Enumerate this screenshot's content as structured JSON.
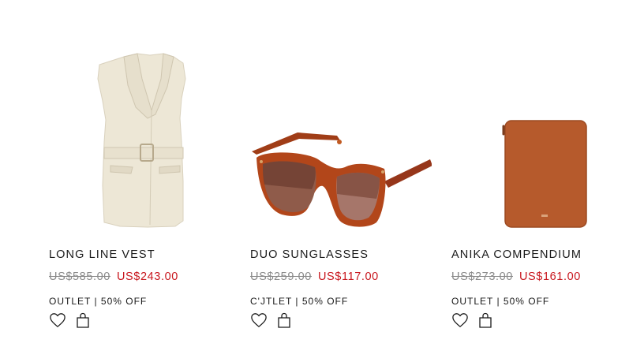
{
  "products": [
    {
      "name": "LONG LINE VEST",
      "original_price": "US$585.00",
      "sale_price": "US$243.00",
      "badge": "OUTLET | 50% OFF",
      "image_icon": "vest-image",
      "wishlist_icon": "heart-icon",
      "bag_icon": "shopping-bag-icon"
    },
    {
      "name": "DUO SUNGLASSES",
      "original_price": "US$259.00",
      "sale_price": "US$117.00",
      "badge": "C'JTLET | 50% OFF",
      "image_icon": "sunglasses-image",
      "wishlist_icon": "heart-icon",
      "bag_icon": "shopping-bag-icon"
    },
    {
      "name": "ANIKA COMPENDIUM",
      "original_price": "US$273.00",
      "sale_price": "US$161.00",
      "badge": "OUTLET | 50% OFF",
      "image_icon": "compendium-image",
      "wishlist_icon": "heart-icon",
      "bag_icon": "shopping-bag-icon"
    }
  ],
  "colors": {
    "sale": "#c8161d",
    "strikethrough": "#8a8a8a",
    "text": "#1a1a1a"
  }
}
